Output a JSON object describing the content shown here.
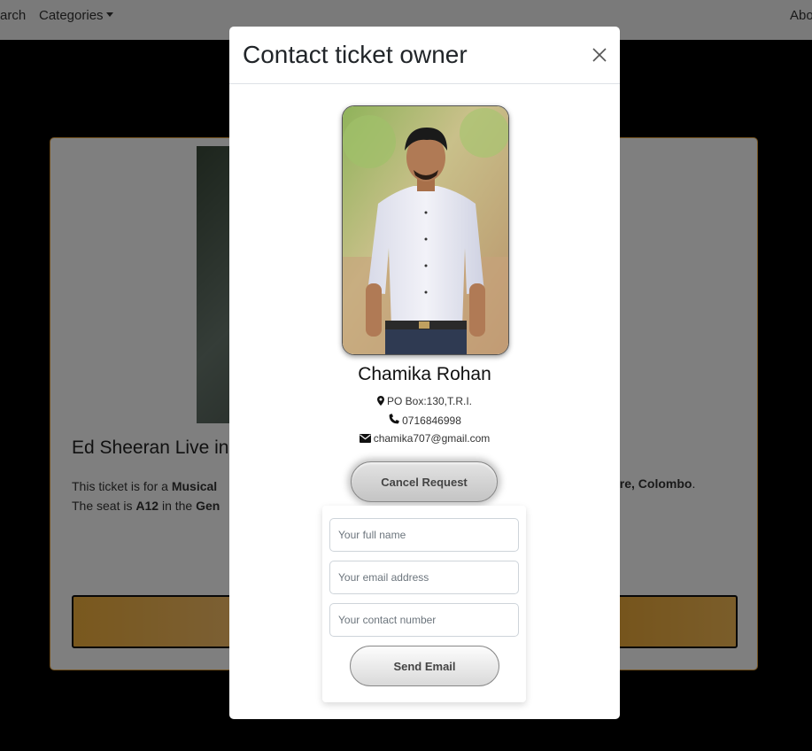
{
  "navbar": {
    "search_label": "arch",
    "categories_label": "Categories",
    "right_label": "Abo"
  },
  "background": {
    "card_title": "Ed Sheeran Live in",
    "desc_line1_start": "This ticket is for a ",
    "desc_line1_bold": "Musical",
    "desc_line1_right": "heatre, Colombo",
    "desc_line2_start": "The seat is ",
    "desc_line2_bold": "A12",
    "desc_line2_mid": " in the ",
    "desc_line2_bold2": "Gen"
  },
  "modal": {
    "title": "Contact ticket owner",
    "owner": {
      "name": "Chamika Rohan",
      "address": "PO Box:130,T.R.I.",
      "phone": "0716846998",
      "email": "chamika707@gmail.com"
    },
    "cancel_label": "Cancel Request",
    "form": {
      "name_placeholder": "Your full name",
      "email_placeholder": "Your email address",
      "phone_placeholder": "Your contact number",
      "send_label": "Send Email"
    }
  },
  "colors": {
    "accent_orange": "#f3b13c",
    "backdrop": "rgba(0,0,0,0.5)"
  }
}
